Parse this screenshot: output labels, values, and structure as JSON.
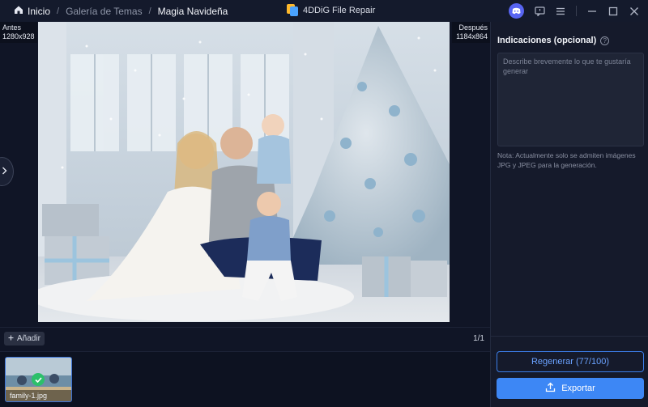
{
  "breadcrumb": {
    "home": "Inicio",
    "gallery": "Galería de Temas",
    "current": "Magia Navideña"
  },
  "app": {
    "title": "4DDiG File Repair"
  },
  "preview": {
    "before_label": "Antes",
    "before_size": "1280x928",
    "after_label": "Después",
    "after_size": "1184x864"
  },
  "toolbar": {
    "add_label": "Añadir",
    "pager": "1/1"
  },
  "thumbnails": [
    {
      "name": "family-1.jpg",
      "selected": true
    }
  ],
  "panel": {
    "title": "Indicaciones (opcional)",
    "prompt_placeholder": "Describe brevemente lo que te gustaría generar",
    "prompt_value": "",
    "note": "Nota: Actualmente solo se admiten imágenes JPG y JPEG para la generación.",
    "regenerate_label": "Regenerar (77/100)",
    "export_label": "Exportar"
  },
  "colors": {
    "accent": "#3d87f5",
    "background": "#101526",
    "panel": "#151a2b",
    "success": "#2cc06a",
    "discord": "#5865f2"
  },
  "icons": [
    "home-icon",
    "app-logo-icon",
    "discord-icon",
    "feedback-icon",
    "menu-icon",
    "minimize-icon",
    "maximize-icon",
    "close-icon",
    "chevron-right-icon",
    "plus-icon",
    "check-icon",
    "help-icon",
    "upload-icon"
  ]
}
